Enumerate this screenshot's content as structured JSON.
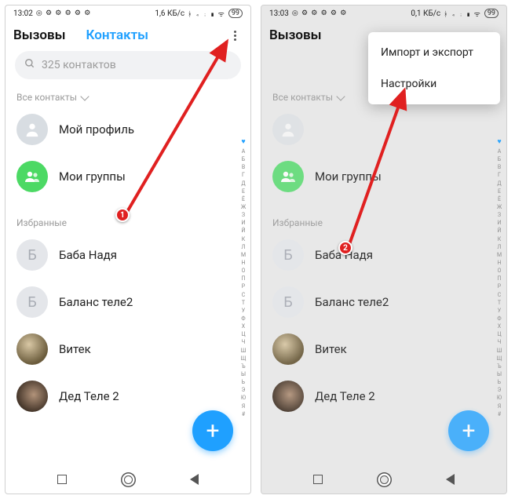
{
  "phone1": {
    "time": "13:02",
    "net_speed": "1,6 КБ/с",
    "battery": "99",
    "tabs": {
      "calls": "Вызовы",
      "contacts": "Контакты"
    },
    "search_placeholder": "325 контактов",
    "all_contacts_label": "Все контакты",
    "profile_label": "Мой профиль",
    "groups_label": "Мои группы",
    "favorites_label": "Избранные",
    "contacts": [
      {
        "initial": "Б",
        "name": "Баба Надя"
      },
      {
        "initial": "Б",
        "name": "Баланс теле2"
      },
      {
        "initial": "",
        "name": "Витек"
      },
      {
        "initial": "",
        "name": "Дед Теле 2"
      }
    ],
    "index": [
      "А",
      "Б",
      "В",
      "Г",
      "Д",
      "Е",
      "Ё",
      "Ж",
      "З",
      "И",
      "Й",
      "К",
      "Л",
      "М",
      "Н",
      "О",
      "П",
      "Р",
      "С",
      "Т",
      "У",
      "Ф",
      "Х",
      "Ц",
      "Ч",
      "Ш",
      "Щ",
      "Ъ",
      "Ы",
      "Ь",
      "Э",
      "Ю",
      "Я",
      "#"
    ],
    "badge": "1"
  },
  "phone2": {
    "time": "13:03",
    "net_speed": "0,1 КБ/с",
    "battery": "99",
    "tabs": {
      "calls": "Вызовы"
    },
    "menu": {
      "item1": "Импорт и экспорт",
      "item2": "Настройки"
    },
    "all_contacts_label": "Все контакты",
    "groups_label": "Мои группы",
    "favorites_label": "Избранные",
    "contacts": [
      {
        "initial": "Б",
        "name": "Баба Надя"
      },
      {
        "initial": "Б",
        "name": "Баланс теле2"
      },
      {
        "initial": "",
        "name": "Витек"
      },
      {
        "initial": "",
        "name": "Дед Теле 2"
      }
    ],
    "badge": "2"
  }
}
